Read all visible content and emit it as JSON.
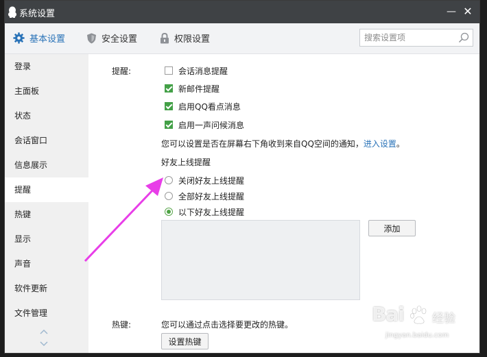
{
  "window": {
    "title": "系统设置",
    "minimize_glyph": "—",
    "close_glyph": "✕"
  },
  "tabs": [
    {
      "label": "基本设置",
      "icon": "gear-icon",
      "active": true
    },
    {
      "label": "安全设置",
      "icon": "shield-icon",
      "active": false
    },
    {
      "label": "权限设置",
      "icon": "lock-icon",
      "active": false
    }
  ],
  "search": {
    "placeholder": "搜索设置项"
  },
  "sidebar": {
    "items": [
      {
        "label": "登录"
      },
      {
        "label": "主面板"
      },
      {
        "label": "状态"
      },
      {
        "label": "会话窗口"
      },
      {
        "label": "信息展示"
      },
      {
        "label": "提醒",
        "active": true
      },
      {
        "label": "热键"
      },
      {
        "label": "显示"
      },
      {
        "label": "声音"
      },
      {
        "label": "软件更新"
      },
      {
        "label": "文件管理"
      }
    ]
  },
  "reminder": {
    "section_label": "提醒:",
    "checkboxes": [
      {
        "label": "会话消息提醒",
        "checked": false
      },
      {
        "label": "新邮件提醒",
        "checked": true
      },
      {
        "label": "启用QQ看点消息",
        "checked": true
      },
      {
        "label": "启用一声问候消息",
        "checked": true
      }
    ],
    "notice_text": "您可以设置是否在屏幕右下角收到来自QQ空间的通知，",
    "notice_link": "进入设置",
    "notice_end": "。",
    "friend_online_title": "好友上线提醒",
    "radios": [
      {
        "label": "关闭好友上线提醒",
        "checked": false
      },
      {
        "label": "全部好友上线提醒",
        "checked": false
      },
      {
        "label": "以下好友上线提醒",
        "checked": true
      }
    ],
    "add_button": "添加"
  },
  "hotkey": {
    "section_label": "热键:",
    "description": "您可以通过点击选择要更改的热键。",
    "button": "设置热键"
  },
  "annotation": {
    "arrow_color": "#e83ee8"
  },
  "watermark": {
    "logo": "Bai",
    "logo_end": "经验",
    "url": "jingyan.baidu.com"
  },
  "colors": {
    "titlebar": "#3f4245",
    "accent": "#2a73b8",
    "check_green": "#43a047"
  }
}
